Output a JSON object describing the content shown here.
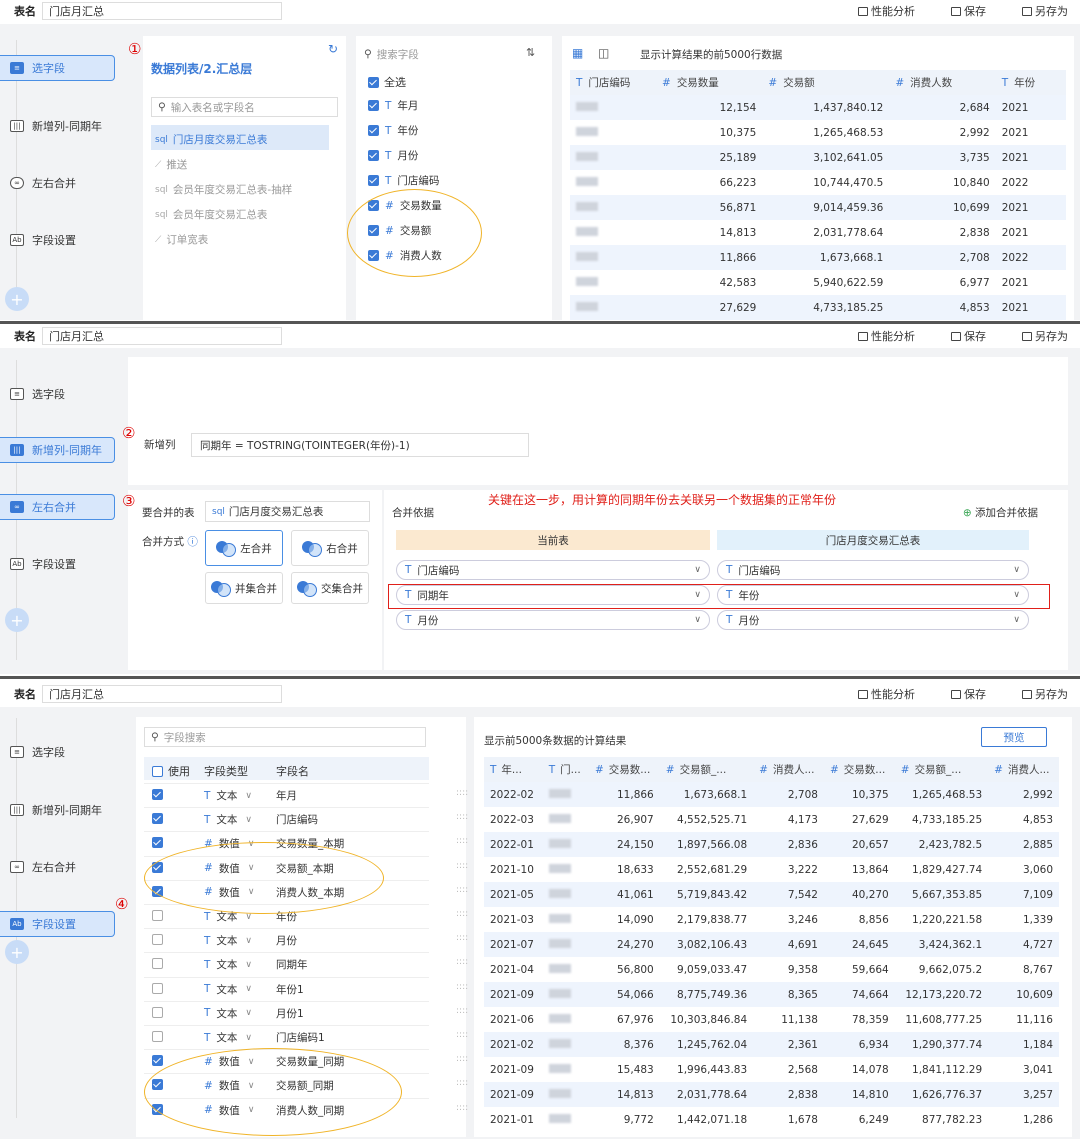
{
  "topbar": {
    "label": "表名",
    "name": "门店月汇总",
    "perf": "性能分析",
    "save": "保存",
    "saveas": "另存为"
  },
  "steps": [
    "选字段",
    "新增列-同期年",
    "左右合并",
    "字段设置"
  ],
  "circles": [
    "①",
    "②",
    "③",
    "④"
  ],
  "s1": {
    "ds_title": "数据列表/2.汇总层",
    "ds_search": "输入表名或字段名",
    "ds_items": [
      "门店月度交易汇总表",
      "推送",
      "会员年度交易汇总表-抽样",
      "会员年度交易汇总表",
      "订单宽表"
    ],
    "ds_prefix": [
      "sql",
      "",
      "sql",
      "sql",
      ""
    ],
    "f_search": "搜索字段",
    "select_all": "全选",
    "fields": [
      {
        "t": "T",
        "n": "年月"
      },
      {
        "t": "T",
        "n": "年份"
      },
      {
        "t": "T",
        "n": "月份"
      },
      {
        "t": "T",
        "n": "门店编码"
      },
      {
        "t": "#",
        "n": "交易数量"
      },
      {
        "t": "#",
        "n": "交易额"
      },
      {
        "t": "#",
        "n": "消费人数"
      }
    ],
    "result_note": "显示计算结果的前5000行数据",
    "cols": [
      {
        "t": "T",
        "n": "门店编码"
      },
      {
        "t": "#",
        "n": "交易数量"
      },
      {
        "t": "#",
        "n": "交易额"
      },
      {
        "t": "#",
        "n": "消费人数"
      },
      {
        "t": "T",
        "n": "年份"
      }
    ],
    "rows": [
      [
        "12,154",
        "1,437,840.12",
        "2,684",
        "2021"
      ],
      [
        "10,375",
        "1,265,468.53",
        "2,992",
        "2021"
      ],
      [
        "25,189",
        "3,102,641.05",
        "3,735",
        "2021"
      ],
      [
        "66,223",
        "10,744,470.5",
        "10,840",
        "2022"
      ],
      [
        "56,871",
        "9,014,459.36",
        "10,699",
        "2021"
      ],
      [
        "14,813",
        "2,031,778.64",
        "2,838",
        "2021"
      ],
      [
        "11,866",
        "1,673,668.1",
        "2,708",
        "2022"
      ],
      [
        "42,583",
        "5,940,622.59",
        "6,977",
        "2021"
      ],
      [
        "27,629",
        "4,733,185.25",
        "4,853",
        "2021"
      ]
    ]
  },
  "s2": {
    "newcol_label": "新增列",
    "formula": "同期年 = TOSTRING(TOINTEGER(年份)-1)",
    "note": "关键在这一步，用计算的同期年份去关联另一个数据集的正常年份",
    "merge_table_label": "要合并的表",
    "merge_table": "门店月度交易汇总表",
    "merge_mode_label": "合并方式",
    "modes": [
      "左合并",
      "右合并",
      "并集合并",
      "交集合并"
    ],
    "basis_label": "合并依据",
    "add_basis": "添加合并依据",
    "cur_table": "当前表",
    "other_table": "门店月度交易汇总表",
    "pairs": [
      [
        "门店编码",
        "门店编码"
      ],
      [
        "同期年",
        "年份"
      ],
      [
        "月份",
        "月份"
      ]
    ]
  },
  "s3": {
    "search": "字段搜索",
    "h_use": "使用",
    "h_type": "字段类型",
    "h_name": "字段名",
    "fields": [
      {
        "c": true,
        "t": "T",
        "ty": "文本",
        "n": "年月"
      },
      {
        "c": true,
        "t": "T",
        "ty": "文本",
        "n": "门店编码"
      },
      {
        "c": true,
        "t": "#",
        "ty": "数值",
        "n": "交易数量_本期"
      },
      {
        "c": true,
        "t": "#",
        "ty": "数值",
        "n": "交易额_本期"
      },
      {
        "c": true,
        "t": "#",
        "ty": "数值",
        "n": "消费人数_本期"
      },
      {
        "c": false,
        "t": "T",
        "ty": "文本",
        "n": "年份"
      },
      {
        "c": false,
        "t": "T",
        "ty": "文本",
        "n": "月份"
      },
      {
        "c": false,
        "t": "T",
        "ty": "文本",
        "n": "同期年"
      },
      {
        "c": false,
        "t": "T",
        "ty": "文本",
        "n": "年份1"
      },
      {
        "c": false,
        "t": "T",
        "ty": "文本",
        "n": "月份1"
      },
      {
        "c": false,
        "t": "T",
        "ty": "文本",
        "n": "门店编码1"
      },
      {
        "c": true,
        "t": "#",
        "ty": "数值",
        "n": "交易数量_同期"
      },
      {
        "c": true,
        "t": "#",
        "ty": "数值",
        "n": "交易额_同期"
      },
      {
        "c": true,
        "t": "#",
        "ty": "数值",
        "n": "消费人数_同期"
      }
    ],
    "result_note": "显示前5000条数据的计算结果",
    "preview": "预览",
    "cols": [
      {
        "t": "T",
        "n": "年..."
      },
      {
        "t": "T",
        "n": "门..."
      },
      {
        "t": "#",
        "n": "交易数..."
      },
      {
        "t": "#",
        "n": "交易额_..."
      },
      {
        "t": "#",
        "n": "消费人..."
      },
      {
        "t": "#",
        "n": "交易数..."
      },
      {
        "t": "#",
        "n": "交易额_..."
      },
      {
        "t": "#",
        "n": "消费人..."
      }
    ],
    "rows": [
      [
        "2022-02",
        "11,866",
        "1,673,668.1",
        "2,708",
        "10,375",
        "1,265,468.53",
        "2,992"
      ],
      [
        "2022-03",
        "26,907",
        "4,552,525.71",
        "4,173",
        "27,629",
        "4,733,185.25",
        "4,853"
      ],
      [
        "2022-01",
        "24,150",
        "1,897,566.08",
        "2,836",
        "20,657",
        "2,423,782.5",
        "2,885"
      ],
      [
        "2021-10",
        "18,633",
        "2,552,681.29",
        "3,222",
        "13,864",
        "1,829,427.74",
        "3,060"
      ],
      [
        "2021-05",
        "41,061",
        "5,719,843.42",
        "7,542",
        "40,270",
        "5,667,353.85",
        "7,109"
      ],
      [
        "2021-03",
        "14,090",
        "2,179,838.77",
        "3,246",
        "8,856",
        "1,220,221.58",
        "1,339"
      ],
      [
        "2021-07",
        "24,270",
        "3,082,106.43",
        "4,691",
        "24,645",
        "3,424,362.1",
        "4,727"
      ],
      [
        "2021-04",
        "56,800",
        "9,059,033.47",
        "9,358",
        "59,664",
        "9,662,075.2",
        "8,767"
      ],
      [
        "2021-09",
        "54,066",
        "8,775,749.36",
        "8,365",
        "74,664",
        "12,173,220.72",
        "10,609"
      ],
      [
        "2021-06",
        "67,976",
        "10,303,846.84",
        "11,138",
        "78,359",
        "11,608,777.25",
        "11,116"
      ],
      [
        "2021-02",
        "8,376",
        "1,245,762.04",
        "2,361",
        "6,934",
        "1,290,377.74",
        "1,184"
      ],
      [
        "2021-09",
        "15,483",
        "1,996,443.83",
        "2,568",
        "14,078",
        "1,841,112.29",
        "3,041"
      ],
      [
        "2021-09",
        "14,813",
        "2,031,778.64",
        "2,838",
        "14,810",
        "1,626,776.37",
        "3,257"
      ],
      [
        "2021-01",
        "9,772",
        "1,442,071.18",
        "1,678",
        "6,249",
        "877,782.23",
        "1,286"
      ]
    ]
  }
}
